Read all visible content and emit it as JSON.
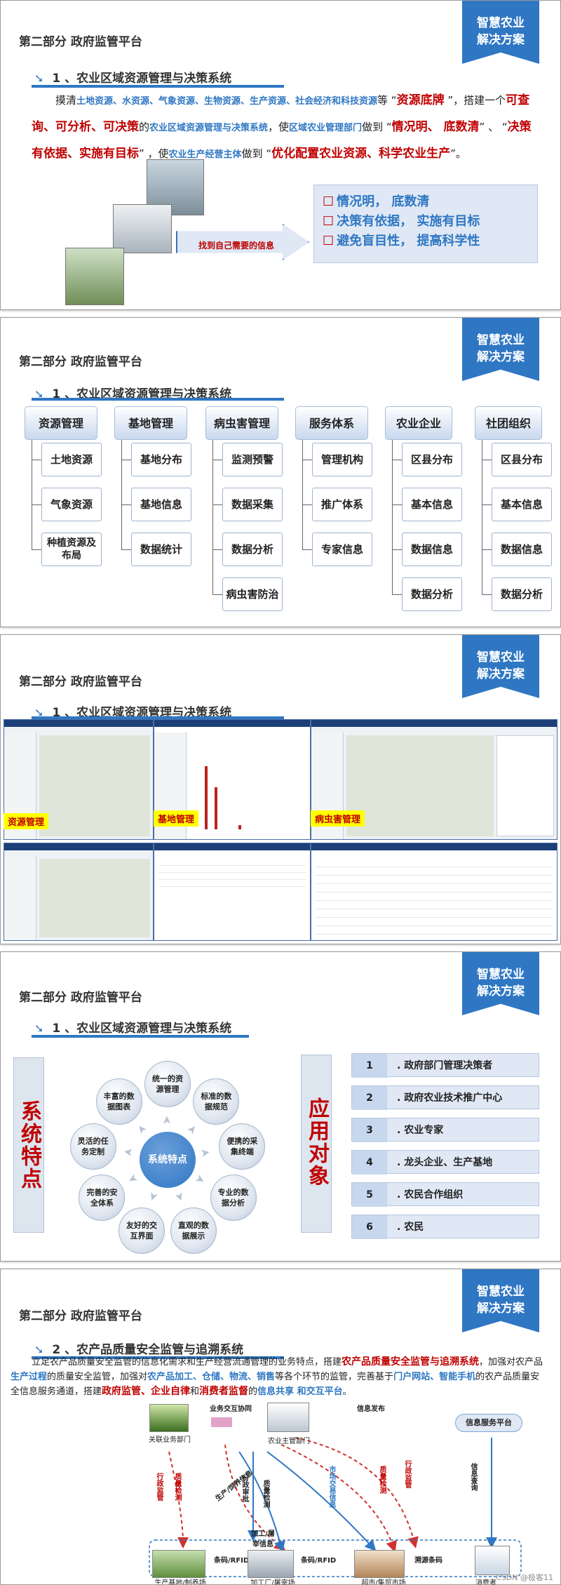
{
  "badge": {
    "line1": "智慧农业",
    "line2": "解决方案"
  },
  "part_title": "第二部分  政府监管平台",
  "slide1": {
    "section": "1 、农业区域资源管理与决策系统",
    "para": [
      {
        "t": "摸清",
        "c": "n"
      },
      {
        "t": "土地资源、水资源、气象资源、生物资源、生产资源、社会经济和科技资源",
        "c": "b"
      },
      {
        "t": "等 “",
        "c": "n"
      },
      {
        "t": "资源底牌",
        "c": "r"
      },
      {
        "t": " ”，搭建一个",
        "c": "n"
      },
      {
        "t": "可查询、可分析、可决策",
        "c": "r"
      },
      {
        "t": "的",
        "c": "n"
      },
      {
        "t": "农业区域资源管理与决策系统",
        "c": "b"
      },
      {
        "t": "，使",
        "c": "n"
      },
      {
        "t": "区域农业管理部门",
        "c": "b"
      },
      {
        "t": "做到 “",
        "c": "n"
      },
      {
        "t": "情况明、 底数清",
        "c": "r"
      },
      {
        "t": "” 、 “",
        "c": "n"
      },
      {
        "t": "决策有依据、实施有目标",
        "c": "r"
      },
      {
        "t": "” ，使",
        "c": "n"
      },
      {
        "t": "农业生产经营主体",
        "c": "b"
      },
      {
        "t": "做到 “",
        "c": "n"
      },
      {
        "t": "优化配置农业资源、科学农业生产",
        "c": "r"
      },
      {
        "t": "”。",
        "c": "n"
      }
    ],
    "callout": "找到自己需要的信息",
    "results": [
      "情况明，  底数清",
      "决策有依据，  实施有目标",
      "避免盲目性，  提高科学性"
    ]
  },
  "slide2": {
    "section": "1 、农业区域资源管理与决策系统",
    "columns": [
      {
        "head": "资源管理",
        "items": [
          "土地资源",
          "气象资源",
          "种植资源及布局"
        ]
      },
      {
        "head": "基地管理",
        "items": [
          "基地分布",
          "基地信息",
          "数据统计"
        ]
      },
      {
        "head": "病虫害管理",
        "items": [
          "监测预警",
          "数据采集",
          "数据分析",
          "病虫害防治"
        ]
      },
      {
        "head": "服务体系",
        "items": [
          "管理机构",
          "推广体系",
          "专家信息"
        ]
      },
      {
        "head": "农业企业",
        "items": [
          "区县分布",
          "基本信息",
          "数据信息",
          "数据分析"
        ]
      },
      {
        "head": "社团组织",
        "items": [
          "区县分布",
          "基本信息",
          "数据信息",
          "数据分析"
        ]
      }
    ]
  },
  "slide3": {
    "section": "1 、农业区域资源管理与决策系统",
    "tags": [
      "资源管理",
      "基地管理",
      "病虫害管理"
    ]
  },
  "slide4": {
    "section": "1 、农业区域资源管理与决策系统",
    "left_panel": "系统特点",
    "right_panel": "应用对象",
    "center": "系统特点",
    "features": [
      "统一的资源管理",
      "标准的数据规范",
      "便携的采集终端",
      "专业的数据分析",
      "直观的数据展示",
      "友好的交互界面",
      "完善的安全体系",
      "灵活的任务定制",
      "丰富的数据图表"
    ],
    "targets": [
      {
        "num": "1",
        "text": ". 政府部门管理决策者"
      },
      {
        "num": "2",
        "text": ". 政府农业技术推广中心"
      },
      {
        "num": "3",
        "text": ". 农业专家"
      },
      {
        "num": "4",
        "text": ". 龙头企业、生产基地"
      },
      {
        "num": "5",
        "text": ". 农民合作组织"
      },
      {
        "num": "6",
        "text": ". 农民"
      }
    ]
  },
  "slide5": {
    "section": "2 、农产品质量安全监管与追溯系统",
    "para": [
      {
        "t": "立足农产品质量安全监管的信息化需求和生产经营流通管理的业务特点，搭建",
        "c": "n"
      },
      {
        "t": "农产品质量安全监管与追溯系统",
        "c": "r"
      },
      {
        "t": "，加强对农产品",
        "c": "n"
      },
      {
        "t": "生产过程",
        "c": "b"
      },
      {
        "t": "的质量安全监管，加强对",
        "c": "n"
      },
      {
        "t": "农产品加工、仓储、物流、销售",
        "c": "b"
      },
      {
        "t": "等各个环节的监管，完善基于",
        "c": "n"
      },
      {
        "t": "门户网站、智能手机",
        "c": "b"
      },
      {
        "t": "的农产品质量安全信息服务通道，搭建",
        "c": "n"
      },
      {
        "t": "政府监管、企业自律",
        "c": "r"
      },
      {
        "t": "和",
        "c": "n"
      },
      {
        "t": "消费者监督",
        "c": "r"
      },
      {
        "t": "的",
        "c": "n"
      },
      {
        "t": "信息共享 和交互平台",
        "c": "b"
      },
      {
        "t": "。",
        "c": "n"
      }
    ],
    "diagram": {
      "top_left": "关联业务部门",
      "top_center": "农业主管部门",
      "top_right": "信息服务平台",
      "link_left": "业务交互协同",
      "link_right": "信息发布",
      "bottom_left": "生产基地/制养场",
      "bottom_mid": "加工厂/屠宰场",
      "bottom_right": "超市/集贸市场",
      "consumer": "消费者",
      "code1": "条码/RFID",
      "code2": "条码/RFID",
      "code3": "溯源条码",
      "labels": [
        "行政监管",
        "质量检测",
        "生产/饲养信息",
        "行政审批",
        "质量检测",
        "加工/屠宰信息",
        "市场交易信息",
        "质量检测",
        "行政监管",
        "信息查询"
      ]
    },
    "watermark": "CSDN @极客11"
  }
}
